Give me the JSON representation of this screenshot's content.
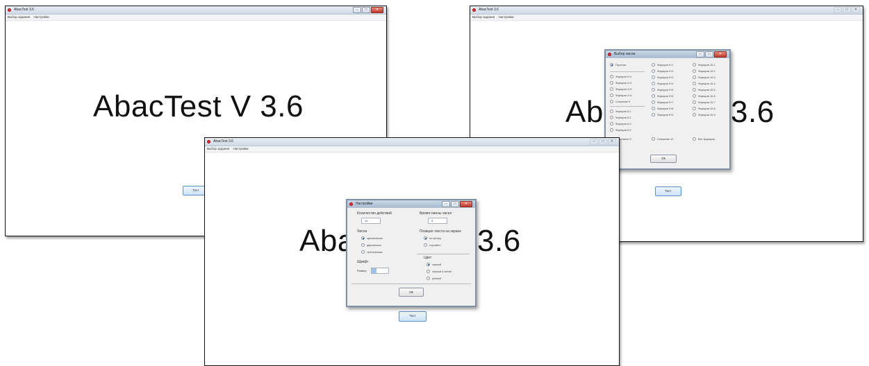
{
  "windows": {
    "left": {
      "title": "AbacTest 3.6",
      "menu": [
        "Выбор задания",
        "Настройки"
      ],
      "heading": "AbacTest V 3.6",
      "start_button": "Тест"
    },
    "right": {
      "title": "AbacTest 3.6",
      "menu": [
        "Выбор задания",
        "Настройки"
      ],
      "heading_left": "Aba",
      "heading_right": "3.6",
      "start_button": "Тест",
      "dialog": {
        "title": "Выбор числа",
        "col1": [
          "Простые",
          "Формула 4+1",
          "Формула 4+2",
          "Формула 4+3",
          "Формула 4+4",
          "Сложение 5",
          "Формула 5-1",
          "Формула 5-2",
          "Формула 5-3",
          "Формула 5-4",
          "Вычитание 5"
        ],
        "col2": [
          "Формула 9+1",
          "Формула 9+2",
          "Формула 9+3",
          "Формула 9+4",
          "Формула 9+5",
          "Формула 9+6",
          "Формула 9+7",
          "Формула 9+8",
          "Формула 9+9",
          "Сложение 10"
        ],
        "col3": [
          "Формула 10-1",
          "Формула 10-2",
          "Формула 10-3",
          "Формула 10-4",
          "Формула 10-5",
          "Формула 10-6",
          "Формула 10-7",
          "Формула 10-8",
          "Формула 10-9",
          "Все формулы"
        ],
        "selected": "Простые",
        "ok": "Ok"
      }
    },
    "front": {
      "title": "AbacTest 3.6",
      "menu": [
        "Выбор задания",
        "Настройки"
      ],
      "heading_left": "Aba",
      "heading_right": "3.6",
      "start_button": "Тест",
      "dialog": {
        "title": "Настройки",
        "actions_label": "Количество действий",
        "actions_value": "10",
        "numbers_label": "Числа",
        "numbers_options": [
          "однозначные",
          "двузначные",
          "трёхзначные"
        ],
        "numbers_selected": "однозначные",
        "font_label": "Шрифт",
        "size_label": "Размер",
        "size_value": "",
        "time_label": "Время смены чисел",
        "time_value": "3",
        "position_label": "Позиция текста на экране",
        "position_options": [
          "по центру",
          "случайно"
        ],
        "position_selected": "по центру",
        "color_label": "Цвет",
        "color_options": [
          "черный",
          "черный и синий",
          "разный"
        ],
        "color_selected": "черный",
        "ok": "Ok"
      }
    }
  },
  "colors": {
    "title_gradient_top": "#e9eef5",
    "close_button": "#c0392b",
    "start_button_border": "#5b8fc7",
    "dialog_background": "#f0f0f0"
  }
}
